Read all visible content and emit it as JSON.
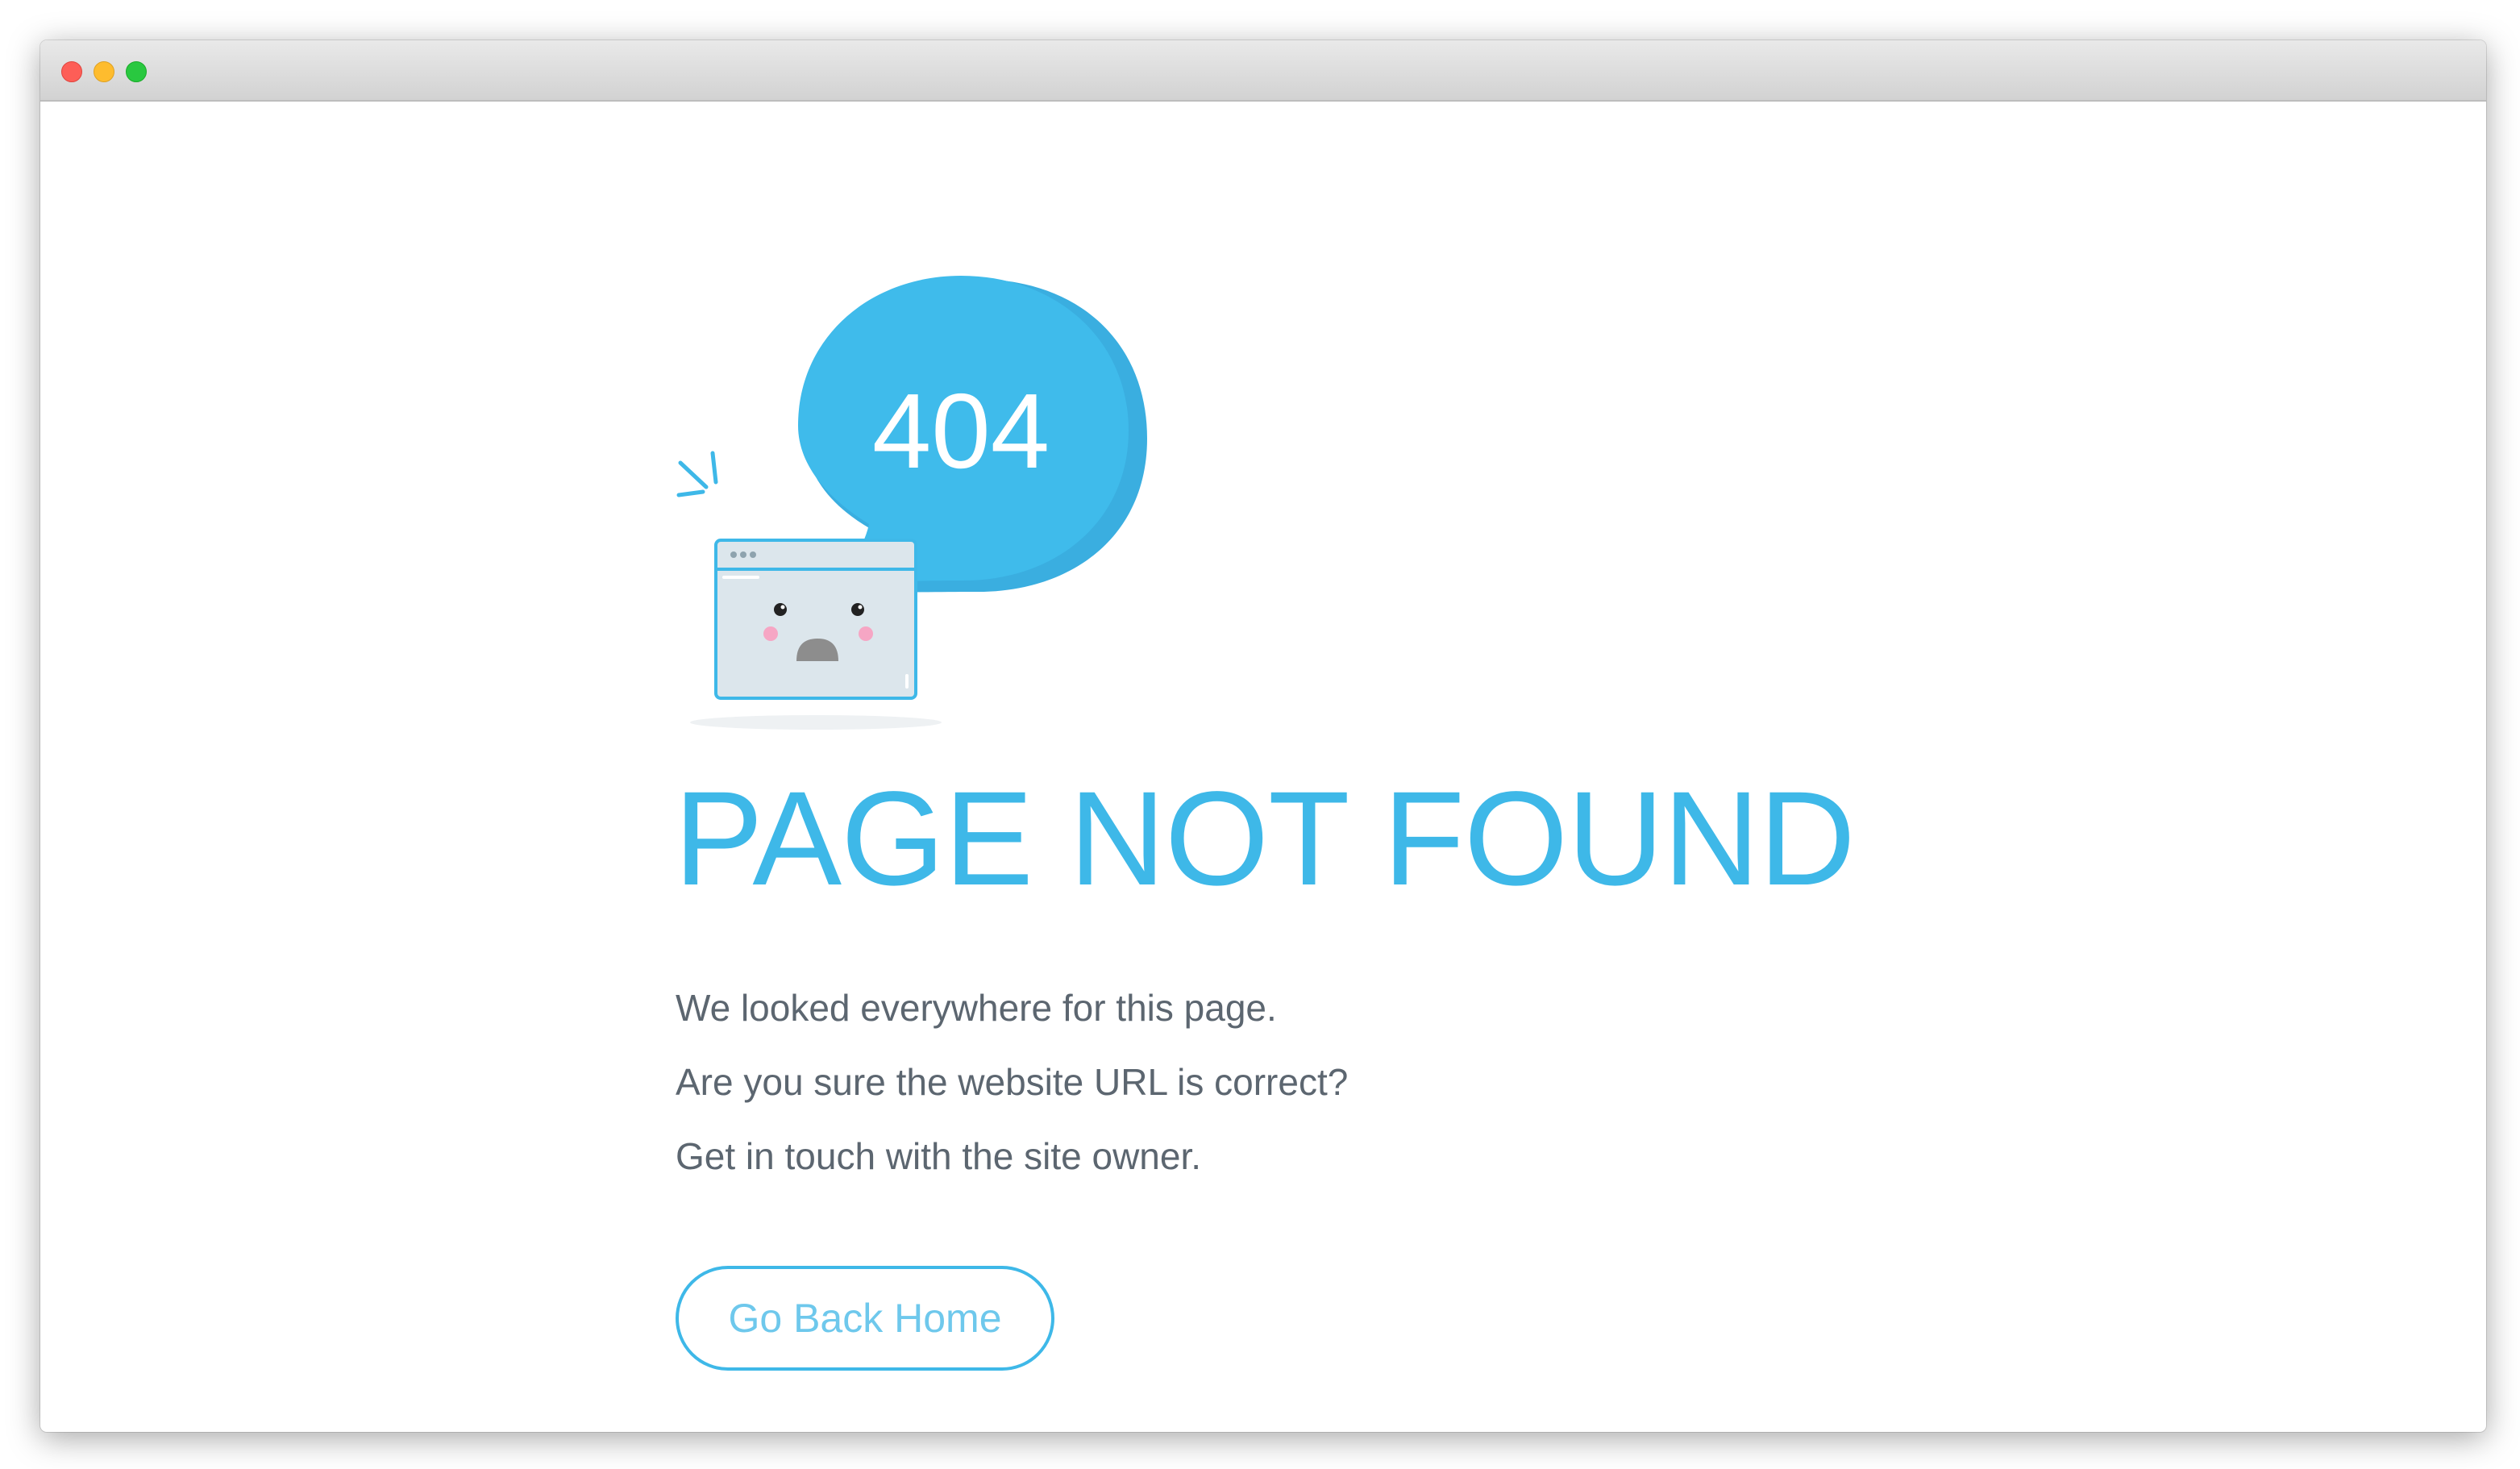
{
  "window": {
    "controls": [
      "close",
      "minimize",
      "maximize"
    ]
  },
  "illustration": {
    "bubble_text": "404",
    "icon": "sad-browser-window-icon",
    "accent_color": "#3eb8e8"
  },
  "error": {
    "heading": "PAGE NOT FOUND",
    "lines": [
      "We looked everywhere for this page.",
      "Are you sure the website URL is correct?",
      "Get in touch with the site owner."
    ]
  },
  "actions": {
    "home_button_label": "Go Back Home"
  },
  "colors": {
    "accent": "#3eb8e8",
    "text": "#5c6670",
    "close": "#fd5e57",
    "minimize": "#febc2e",
    "maximize": "#29c840"
  }
}
